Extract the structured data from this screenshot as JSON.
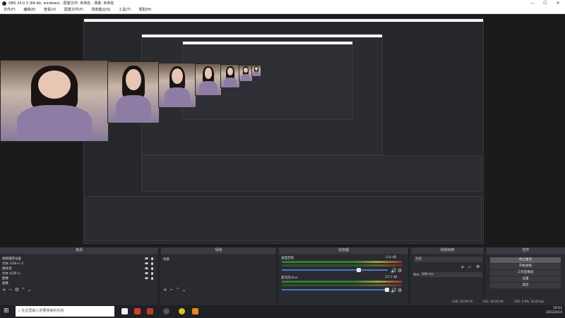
{
  "window": {
    "title": "OBS 24.0.3 (64-bit, windows) - 配置文件: 未命名 - 场景: 未命名"
  },
  "menu": [
    "文件(F)",
    "编辑(E)",
    "查看(V)",
    "配置文件(P)",
    "场景集合(S)",
    "工具(T)",
    "帮助(H)"
  ],
  "docks": {
    "sources": {
      "title": "来源",
      "items": [
        "视频捕获设备",
        "文本 (GDI+) 2",
        "媒体源",
        "文本 (GDI+)",
        "图像",
        "图像"
      ]
    },
    "scenes": {
      "title": "场景",
      "items": [
        "场景"
      ]
    },
    "mixer": {
      "title": "混音器",
      "channels": [
        {
          "name": "桌面音频",
          "db": "-2.6 dB"
        },
        {
          "name": "麦克风/Aux",
          "db": "13.5 dB"
        }
      ]
    },
    "transitions": {
      "title": "场景转换",
      "selected": "淡出",
      "duration_label": "时长",
      "duration_value": "300 ms"
    },
    "controls": {
      "title": "控件",
      "buttons": [
        "停止推流",
        "开始录制",
        "工作室模式",
        "设置",
        "退出"
      ]
    }
  },
  "status": {
    "live": "LIVE: 00:00:00",
    "rec": "REC: 00:00:00",
    "cpu": "CPU: 0.9%, 30.00 fps"
  },
  "taskbar": {
    "search_placeholder": "在这里输入你要搜索的内容",
    "time": "19:51",
    "date": "2022/2/14"
  }
}
